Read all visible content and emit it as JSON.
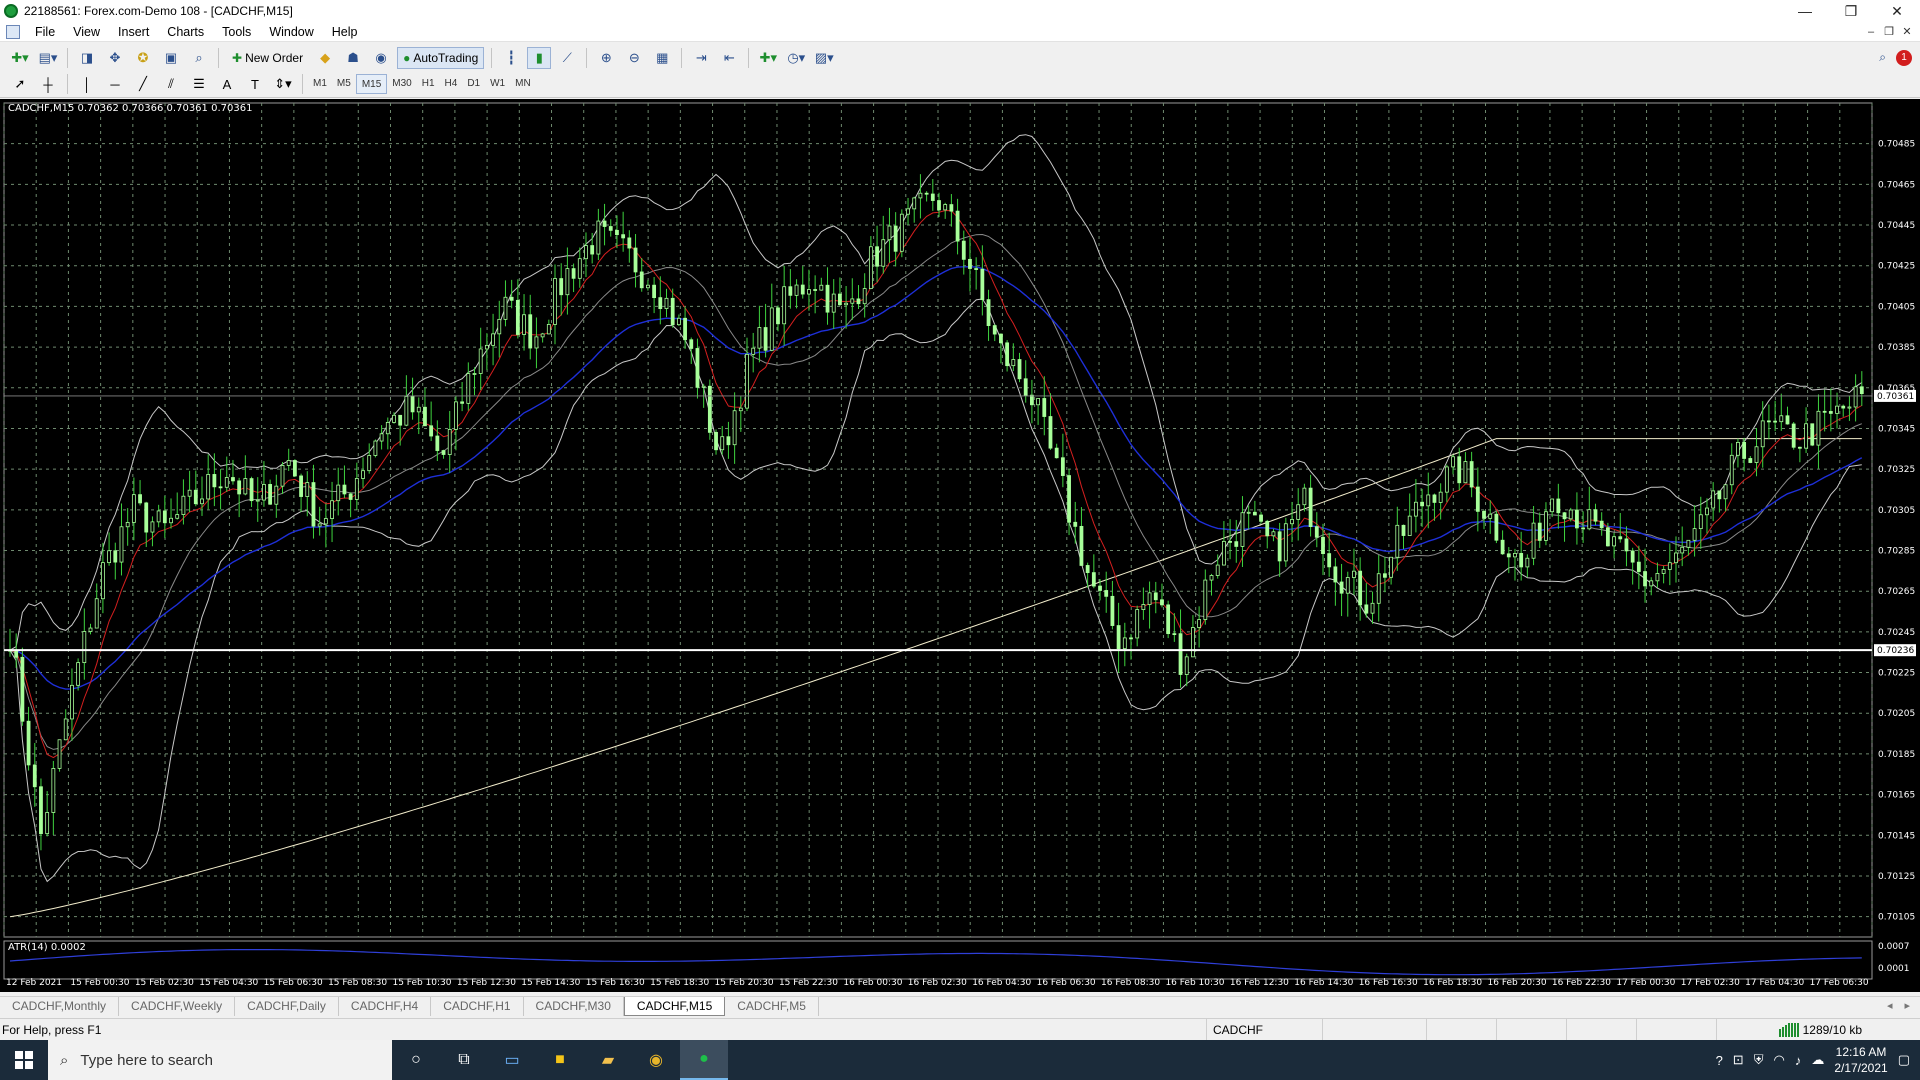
{
  "window": {
    "title": "22188561: Forex.com-Demo 108 - [CADCHF,M15]",
    "controls": [
      "—",
      "❐",
      "✕"
    ]
  },
  "menu": [
    "File",
    "View",
    "Insert",
    "Charts",
    "Tools",
    "Window",
    "Help"
  ],
  "toolbar": {
    "new_order": "New Order",
    "autotrading": "AutoTrading",
    "notification_count": "1"
  },
  "timeframes": [
    "M1",
    "M5",
    "M15",
    "M30",
    "H1",
    "H4",
    "D1",
    "W1",
    "MN"
  ],
  "active_timeframe": "M15",
  "chart": {
    "header": "CADCHF,M15  0.70362 0.70366 0.70361 0.70361",
    "atr_label": "ATR(14) 0.0002",
    "current_price": "0.70361",
    "hline_price": "0.70236",
    "colors": {
      "background": "#000000",
      "grid": "#6f8a6f",
      "candle": "#a8ff9a",
      "wick": "#3fd43f",
      "bollinger": "#c8c8c8",
      "ema_fast": "#d41f1f",
      "ema_slow": "#1e2fd8",
      "sma_long": "#f3edcc",
      "atr": "#2f3fd8"
    }
  },
  "chart_data": {
    "type": "line",
    "symbol": "CADCHF",
    "timeframe": "M15",
    "y_ticks": [
      "0.70485",
      "0.70465",
      "0.70445",
      "0.70425",
      "0.70405",
      "0.70385",
      "0.70365",
      "0.70345",
      "0.70325",
      "0.70305",
      "0.70285",
      "0.70265",
      "0.70245",
      "0.70225",
      "0.70205",
      "0.70185",
      "0.70165",
      "0.70145",
      "0.70125",
      "0.70105"
    ],
    "ylim": [
      0.70095,
      0.70505
    ],
    "atr_ticks": [
      "0.0007",
      "0.0001"
    ],
    "x_ticks": [
      "12 Feb 2021",
      "15 Feb 00:30",
      "15 Feb 02:30",
      "15 Feb 04:30",
      "15 Feb 06:30",
      "15 Feb 08:30",
      "15 Feb 10:30",
      "15 Feb 12:30",
      "15 Feb 14:30",
      "15 Feb 16:30",
      "15 Feb 18:30",
      "15 Feb 20:30",
      "15 Feb 22:30",
      "16 Feb 00:30",
      "16 Feb 02:30",
      "16 Feb 04:30",
      "16 Feb 06:30",
      "16 Feb 08:30",
      "16 Feb 10:30",
      "16 Feb 12:30",
      "16 Feb 14:30",
      "16 Feb 16:30",
      "16 Feb 18:30",
      "16 Feb 20:30",
      "16 Feb 22:30",
      "17 Feb 00:30",
      "17 Feb 02:30",
      "17 Feb 04:30",
      "17 Feb 06:30"
    ],
    "price_path": [
      0.70245,
      0.70145,
      0.70215,
      0.70275,
      0.70305,
      0.70295,
      0.7031,
      0.70325,
      0.70305,
      0.7033,
      0.703,
      0.70315,
      0.70345,
      0.70355,
      0.7033,
      0.70375,
      0.70405,
      0.7039,
      0.7042,
      0.7044,
      0.7043,
      0.70415,
      0.70385,
      0.7033,
      0.7038,
      0.70405,
      0.7042,
      0.704,
      0.7043,
      0.70445,
      0.7046,
      0.7043,
      0.70385,
      0.70365,
      0.7032,
      0.7027,
      0.7024,
      0.70265,
      0.7023,
      0.7028,
      0.703,
      0.70285,
      0.7031,
      0.70275,
      0.7026,
      0.7029,
      0.70315,
      0.70325,
      0.703,
      0.70275,
      0.70315,
      0.703,
      0.70285,
      0.7027,
      0.7028,
      0.703,
      0.7033,
      0.70345,
      0.7034,
      0.7035,
      0.70361
    ]
  },
  "tabs": [
    "CADCHF,Monthly",
    "CADCHF,Weekly",
    "CADCHF,Daily",
    "CADCHF,H4",
    "CADCHF,H1",
    "CADCHF,M30",
    "CADCHF,M15",
    "CADCHF,M5"
  ],
  "active_tab": "CADCHF,M15",
  "status": {
    "help": "For Help, press F1",
    "symbol": "CADCHF",
    "connection": "1289/10 kb"
  },
  "taskbar": {
    "search_placeholder": "Type here to search",
    "time": "12:16 AM",
    "date": "2/17/2021"
  }
}
